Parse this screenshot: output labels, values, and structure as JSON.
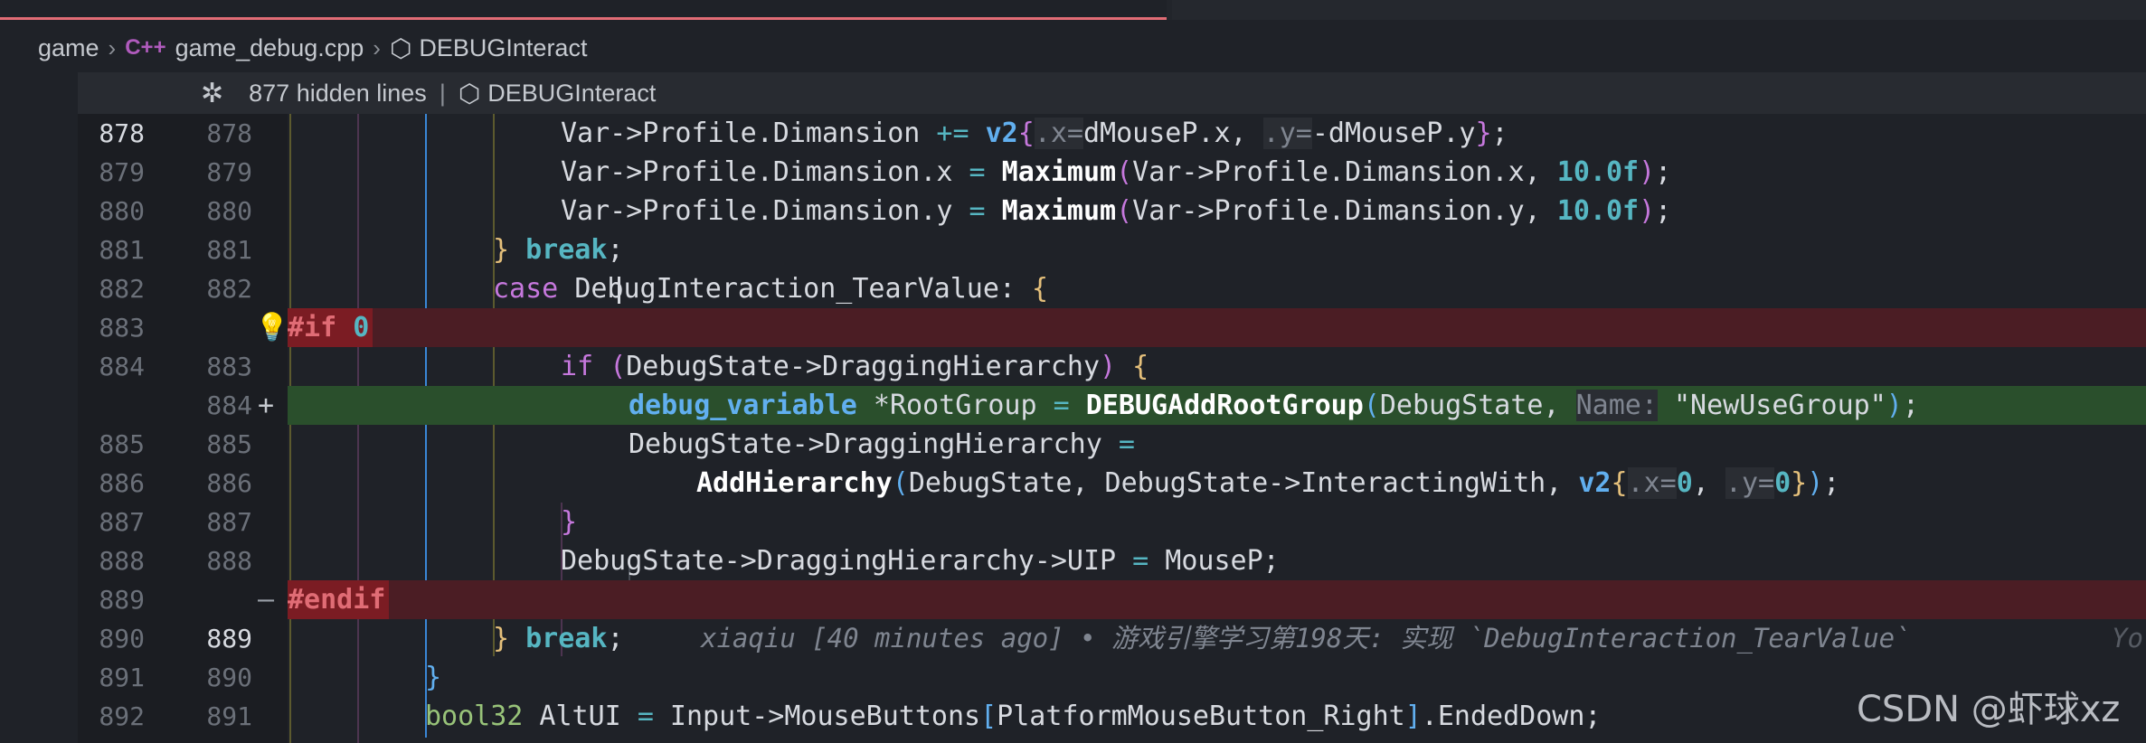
{
  "breadcrumb": {
    "folder": "game",
    "file_icon": "C++",
    "file": "game_debug.cpp",
    "symbol": "DEBUGInteract"
  },
  "sticky": {
    "hidden_lines": "877 hidden lines",
    "separator": "|",
    "symbol": "DEBUGInteract"
  },
  "lines": [
    {
      "left": "878",
      "right": "878"
    },
    {
      "left": "879",
      "right": "879"
    },
    {
      "left": "880",
      "right": "880"
    },
    {
      "left": "881",
      "right": "881"
    },
    {
      "left": "882",
      "right": "882"
    },
    {
      "left": "883",
      "right": ""
    },
    {
      "left": "884",
      "right": "883"
    },
    {
      "left": "",
      "right": "884"
    },
    {
      "left": "885",
      "right": "885"
    },
    {
      "left": "886",
      "right": "886"
    },
    {
      "left": "887",
      "right": "887"
    },
    {
      "left": "888",
      "right": "888"
    },
    {
      "left": "889",
      "right": ""
    },
    {
      "left": "890",
      "right": "889"
    },
    {
      "left": "891",
      "right": "890"
    },
    {
      "left": "892",
      "right": "891"
    }
  ],
  "code": {
    "l878": {
      "a": "Var->Profile.Dimansion ",
      "op": "+=",
      "v2": "v2",
      "hx": ".x=",
      "b": "dMouseP.x, ",
      "hy": ".y=",
      "c": "-dMouseP.y",
      "end": ";"
    },
    "l879": {
      "a": "Var->Profile.Dimansion.x ",
      "op": "=",
      "fn": "Maximum",
      "b": "Var->Profile.Dimansion.x, ",
      "num": "10.0f",
      "end": ";"
    },
    "l880": {
      "a": "Var->Profile.Dimansion.y ",
      "op": "=",
      "fn": "Maximum",
      "b": "Var->Profile.Dimansion.y, ",
      "num": "10.0f",
      "end": ";"
    },
    "l881": {
      "brace": "}",
      "kw": "break",
      "end": ";"
    },
    "l882": {
      "kw": "case",
      "a": "DebugInteraction_TearValue: ",
      "brace": "{"
    },
    "l883": {
      "pre": "#if",
      "num": "0"
    },
    "l884": {
      "kw": "if",
      "a": "DebugState->DraggingHierarchy",
      "end": " {"
    },
    "l884b": {
      "type": "debug_variable",
      "a": " *RootGroup ",
      "op": "=",
      "fn": "DEBUGAddRootGroup",
      "b": "DebugState, ",
      "hint": "Name:",
      "str": " \"NewUseGroup\"",
      "end": ";"
    },
    "l885": {
      "a": "DebugState->DraggingHierarchy ",
      "op": "="
    },
    "l886": {
      "fn": "AddHierarchy",
      "a": "DebugState, DebugState->InteractingWith, ",
      "v2": "v2",
      "hx": ".x=",
      "n1": "0",
      "sep": ", ",
      "hy": ".y=",
      "n2": "0",
      "end": ";"
    },
    "l887": {
      "brace": "}"
    },
    "l888": {
      "a": "DebugState->DraggingHierarchy->UIP ",
      "op": "=",
      "b": " MouseP;"
    },
    "l889": {
      "pre": "#endif"
    },
    "l890": {
      "brace": "}",
      "kw": "break",
      "end": ";",
      "blame": "xiaqiu [40 minutes ago] • 游戏引擎学习第198天: 实现 `DebugInteraction_TearValue`",
      "blame_cut": "Yo"
    },
    "l891": {
      "brace": "}"
    },
    "l892": {
      "type": "bool32",
      "a": " AltUI ",
      "op": "=",
      "b": " Input->MouseButtons",
      "idx": "PlatformMouseButton_Right",
      "c": ".EndedDown;"
    }
  },
  "watermark": "CSDN @虾球xz",
  "colors": {
    "editor_bg": "#1f2228",
    "removed_bg": "#4b1d24",
    "added_bg": "#2a4f2c",
    "keyword": "#c678dd",
    "function": "#ffffff",
    "number": "#56b6c2"
  }
}
